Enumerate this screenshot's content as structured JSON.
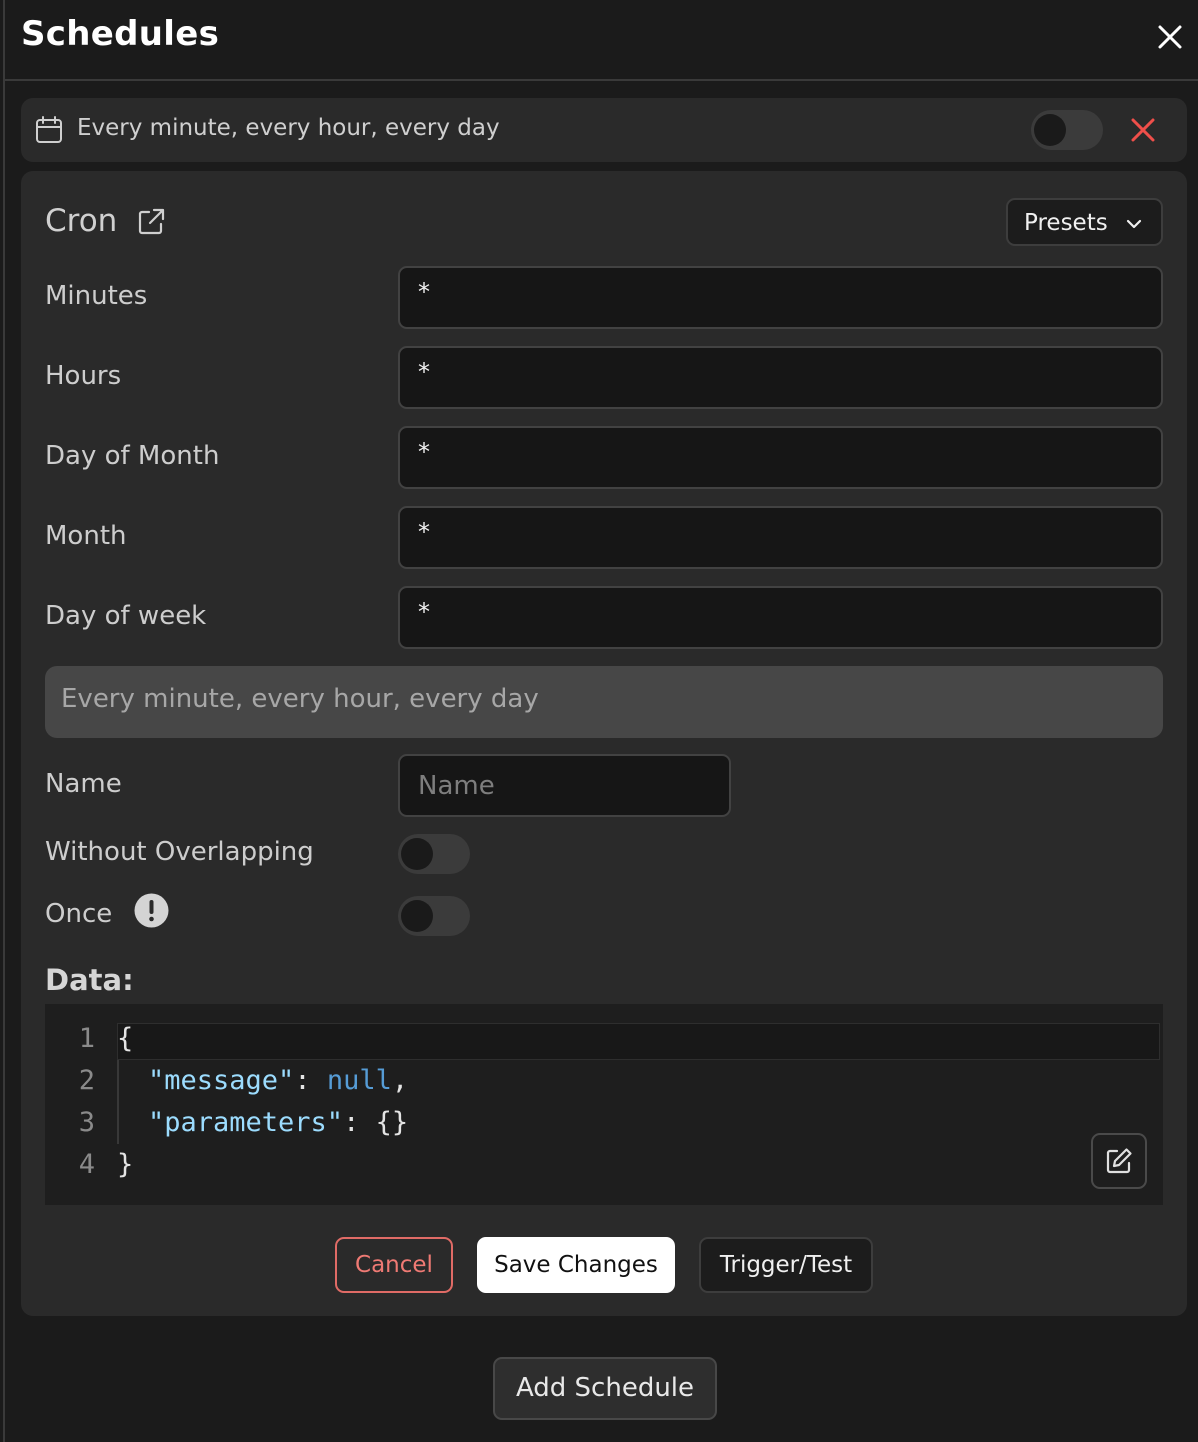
{
  "header": {
    "title": "Schedules",
    "close_icon": "close-icon"
  },
  "schedule": {
    "summary": "Every minute, every hour, every day",
    "enabled": false,
    "calendar_icon": "calendar-icon",
    "remove_color": "#ef4f4a",
    "cron": {
      "title": "Cron",
      "presets_label": "Presets",
      "fields": [
        {
          "label": "Minutes",
          "value": "*"
        },
        {
          "label": "Hours",
          "value": "*"
        },
        {
          "label": "Day of Month",
          "value": "*"
        },
        {
          "label": "Month",
          "value": "*"
        },
        {
          "label": "Day of week",
          "value": "*"
        }
      ],
      "description": "Every minute, every hour, every day"
    },
    "name": {
      "label": "Name",
      "value": "",
      "placeholder": "Name"
    },
    "without_overlapping": {
      "label": "Without Overlapping",
      "value": false
    },
    "once": {
      "label": "Once",
      "value": false,
      "info_icon": "info-icon"
    },
    "data": {
      "label": "Data:",
      "line_numbers": [
        "1",
        "2",
        "3",
        "4"
      ],
      "lines": [
        {
          "text": "{"
        },
        {
          "key": "\"message\"",
          "sep": ": ",
          "val": "null",
          "tail": ","
        },
        {
          "key": "\"parameters\"",
          "sep": ": ",
          "tail": "{}"
        },
        {
          "text": "}"
        }
      ]
    },
    "actions": {
      "cancel": "Cancel",
      "save": "Save Changes",
      "trigger": "Trigger/Test"
    }
  },
  "footer": {
    "add_label": "Add Schedule"
  }
}
